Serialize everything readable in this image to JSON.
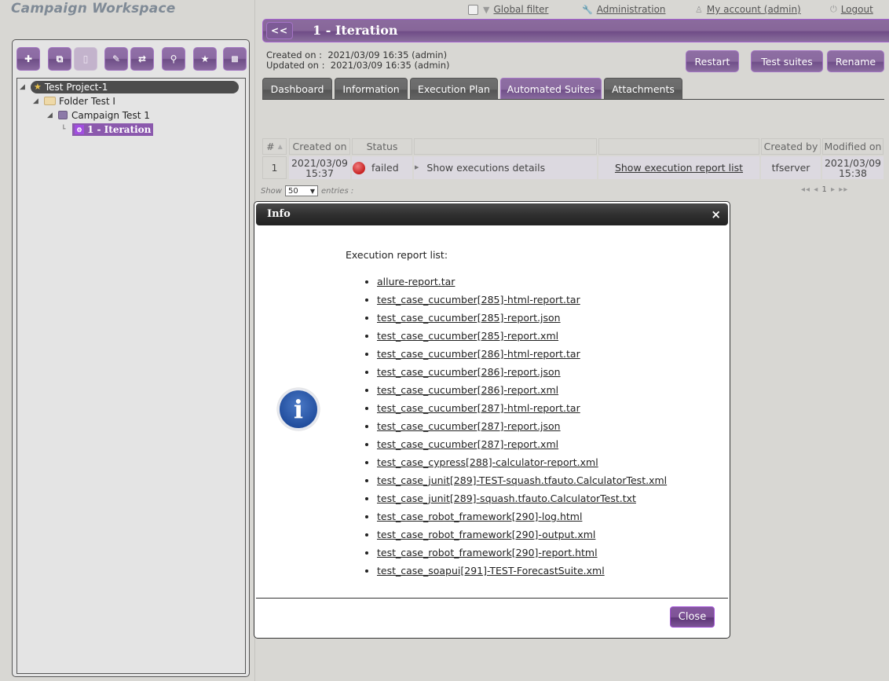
{
  "workspace": {
    "title": "Campaign Workspace"
  },
  "tree_toolbar": [
    {
      "name": "add",
      "icon": "plus-icon",
      "glyph": "✚",
      "disabled": false
    },
    {
      "name": "copy",
      "icon": "copy-icon",
      "glyph": "⧉",
      "disabled": false
    },
    {
      "name": "paste",
      "icon": "clipboard-icon",
      "glyph": "▯",
      "disabled": true
    },
    {
      "name": "rename",
      "icon": "pencil-icon",
      "glyph": "✎",
      "disabled": false
    },
    {
      "name": "move",
      "icon": "swap-arrows-icon",
      "glyph": "⇄",
      "disabled": false
    },
    {
      "name": "search",
      "icon": "magnifier-icon",
      "glyph": "⚲",
      "disabled": false
    },
    {
      "name": "favorite",
      "icon": "star-icon",
      "glyph": "★",
      "disabled": false
    },
    {
      "name": "delete",
      "icon": "trash-icon",
      "glyph": "🗑",
      "disabled": false
    }
  ],
  "tree": {
    "project": "Test Project-1",
    "folder": "Folder Test I",
    "campaign": "Campaign Test 1",
    "iteration": "1 - Iteration"
  },
  "topnav": {
    "global_filter": "Global filter",
    "administration": "Administration",
    "my_account": "My account (admin)",
    "logout": "Logout"
  },
  "header": {
    "back_label": "<<",
    "title": "1 - Iteration",
    "created_label": "Created on :",
    "created_value": "2021/03/09 16:35 (admin)",
    "updated_label": "Updated on :",
    "updated_value": "2021/03/09 16:35 (admin)",
    "buttons": {
      "restart": "Restart",
      "test_suites": "Test suites",
      "rename": "Rename"
    }
  },
  "tabs": [
    {
      "label": "Dashboard",
      "active": false
    },
    {
      "label": "Information",
      "active": false
    },
    {
      "label": "Execution Plan",
      "active": false
    },
    {
      "label": "Automated Suites",
      "active": true
    },
    {
      "label": "Attachments",
      "active": false
    }
  ],
  "suites_table": {
    "columns": [
      "#",
      "Created on",
      "Status",
      "",
      "",
      "Created by",
      "Modified on"
    ],
    "rows": [
      {
        "num": "1",
        "created_date": "2021/03/09",
        "created_time": "15:37",
        "status": "failed",
        "details_link": "Show executions details",
        "report_link": "Show execution report list",
        "created_by": "tfserver",
        "modified_date": "2021/03/09",
        "modified_time": "15:38"
      }
    ],
    "show_label": "Show",
    "page_size": "50",
    "entries_label": "entries :",
    "pager": {
      "first": "◂◂",
      "prev": "◂",
      "page": "1",
      "next": "▸",
      "last": "▸▸"
    }
  },
  "dialog": {
    "title": "Info",
    "close_x": "×",
    "heading": "Execution report list:",
    "reports": [
      "allure-report.tar",
      "test_case_cucumber[285]-html-report.tar",
      "test_case_cucumber[285]-report.json",
      "test_case_cucumber[285]-report.xml",
      "test_case_cucumber[286]-html-report.tar",
      "test_case_cucumber[286]-report.json",
      "test_case_cucumber[286]-report.xml",
      "test_case_cucumber[287]-html-report.tar",
      "test_case_cucumber[287]-report.json",
      "test_case_cucumber[287]-report.xml",
      "test_case_cypress[288]-calculator-report.xml",
      "test_case_junit[289]-TEST-squash.tfauto.CalculatorTest.xml",
      "test_case_junit[289]-squash.tfauto.CalculatorTest.txt",
      "test_case_robot_framework[290]-log.html",
      "test_case_robot_framework[290]-output.xml",
      "test_case_robot_framework[290]-report.html",
      "test_case_soapui[291]-TEST-ForecastSuite.xml"
    ],
    "close_button": "Close"
  },
  "colors": {
    "accent_purple": "#8a6a9f",
    "failed_red": "#c62020",
    "info_blue": "#204c9c"
  }
}
